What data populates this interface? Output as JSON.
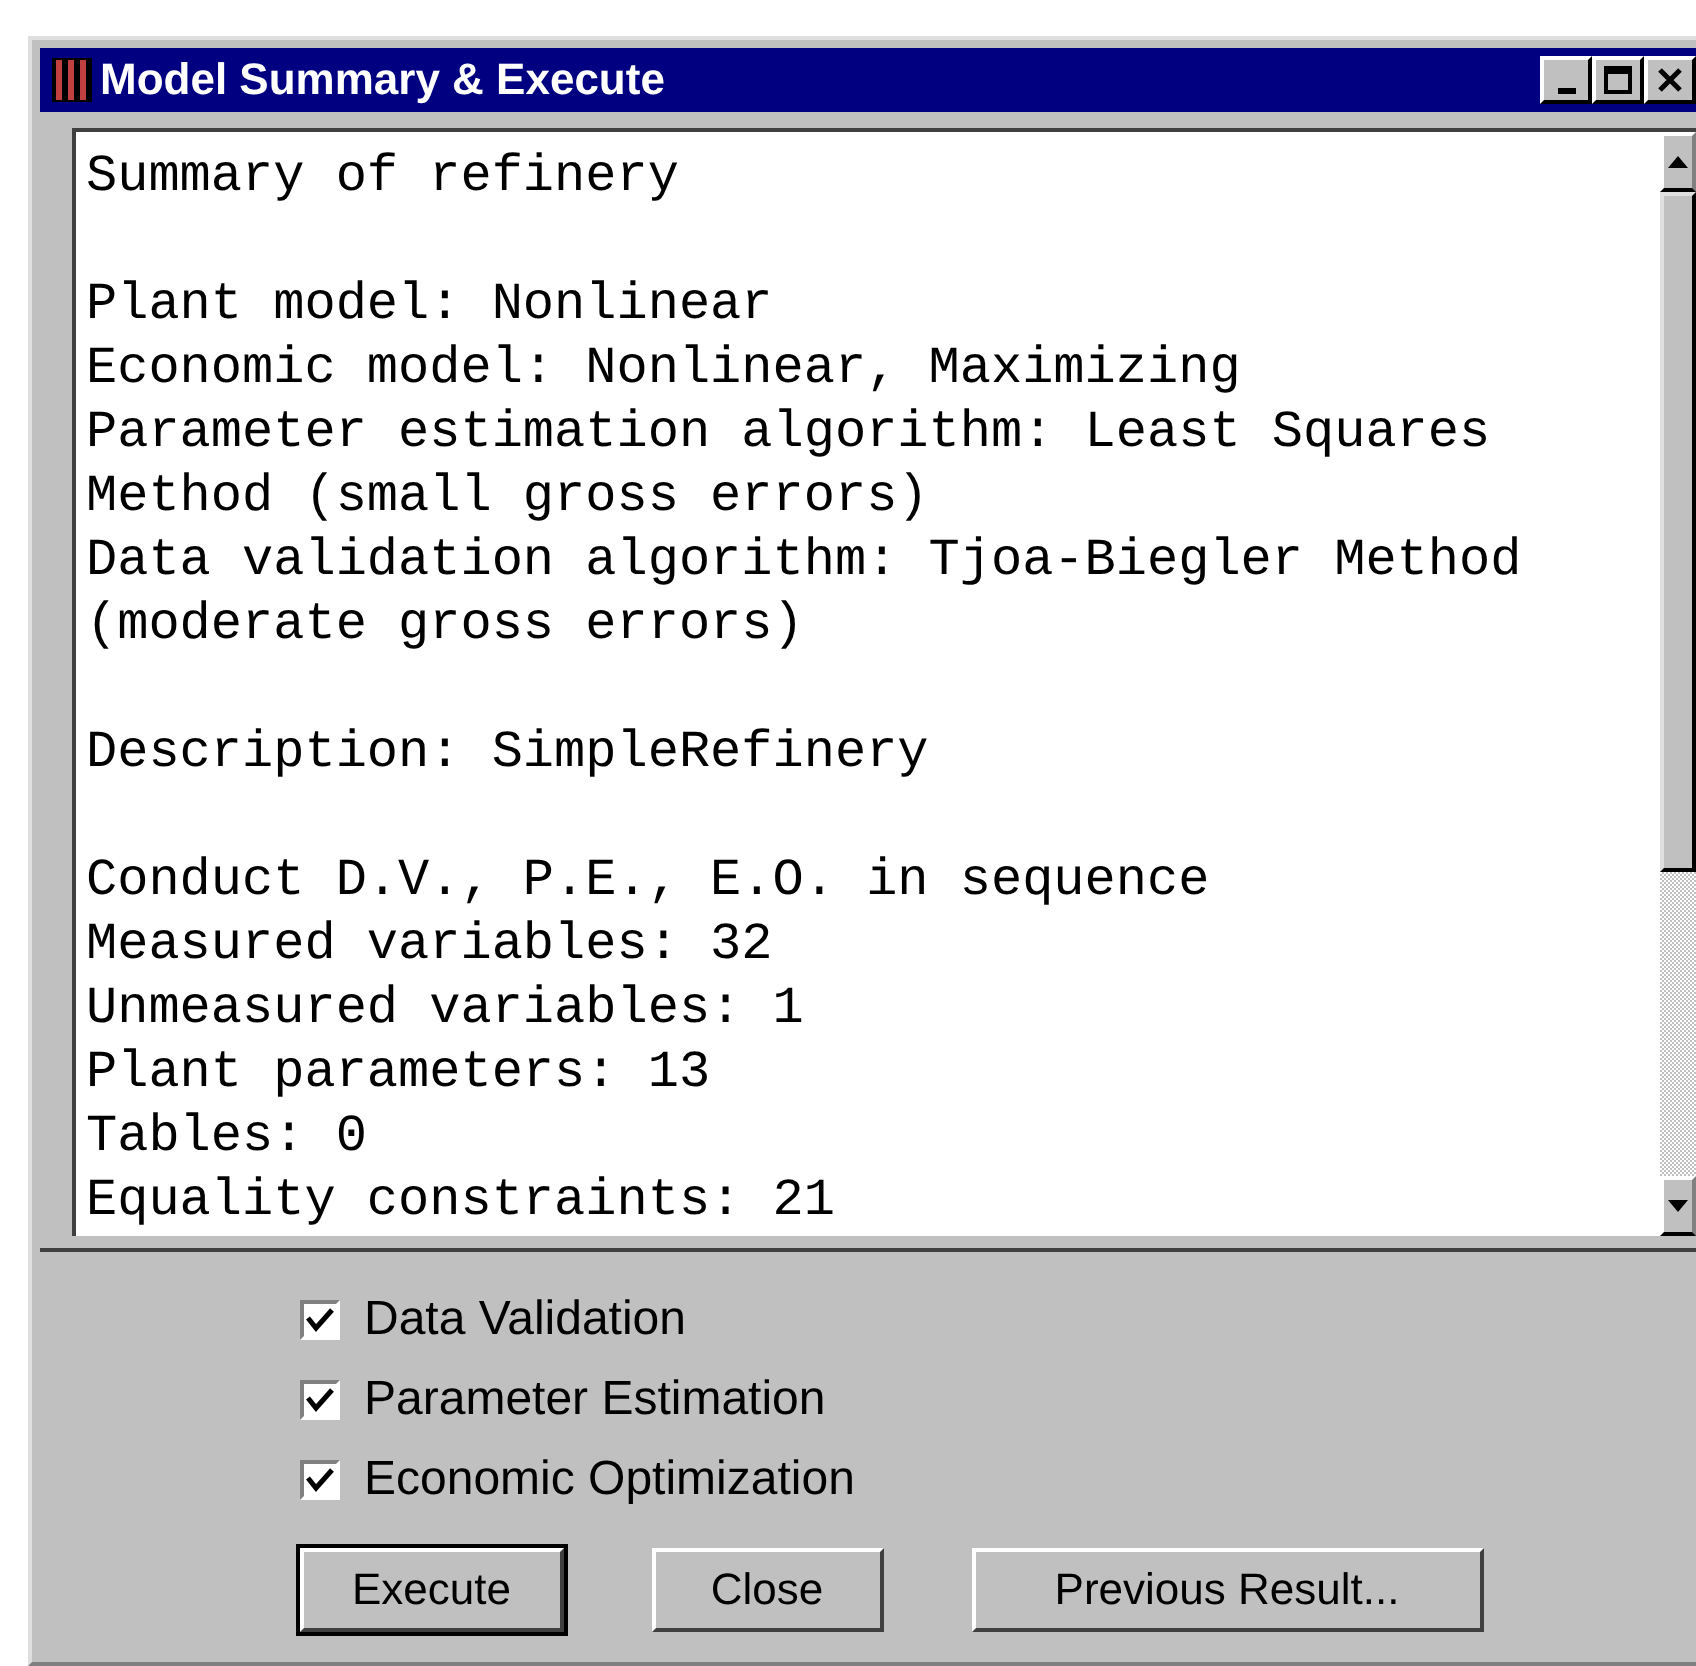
{
  "window": {
    "title": "Model Summary & Execute"
  },
  "summary": {
    "paragraphs": [
      [
        "Summary of refinery"
      ],
      [
        "Plant model: Nonlinear",
        "Economic model: Nonlinear, Maximizing",
        "Parameter estimation algorithm: Least Squares",
        "Method (small gross errors)",
        "Data validation algorithm: Tjoa-Biegler Method",
        "(moderate gross errors)"
      ],
      [
        "Description: SimpleRefinery"
      ],
      [
        "Conduct D.V., P.E., E.O. in sequence",
        "Measured variables: 32",
        "Unmeasured variables: 1",
        "Plant parameters: 13",
        "Tables: 0",
        "Equality constraints: 21"
      ]
    ]
  },
  "options": [
    {
      "label": "Data Validation",
      "checked": true
    },
    {
      "label": "Parameter Estimation",
      "checked": true
    },
    {
      "label": "Economic Optimization",
      "checked": true
    }
  ],
  "buttons": [
    {
      "label": "Execute",
      "default": true
    },
    {
      "label": "Close",
      "default": false
    },
    {
      "label": "Previous Result...",
      "default": false
    }
  ]
}
